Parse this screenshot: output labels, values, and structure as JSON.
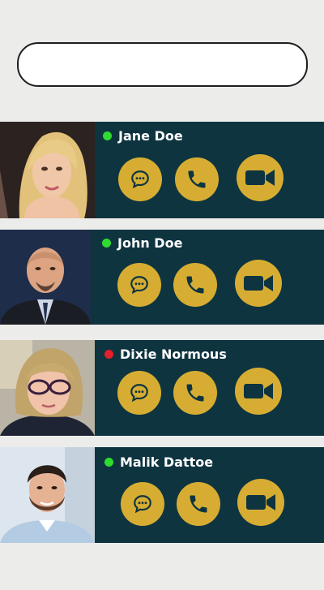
{
  "search": {
    "value": "",
    "placeholder": ""
  },
  "colors": {
    "page_bg": "#ececea",
    "card_bg": "#0e3440",
    "action_gold": "#d6ad32",
    "status_online": "#2fdb2f",
    "status_busy": "#e5202a"
  },
  "contacts": [
    {
      "name": "Jane Doe",
      "status": "online",
      "actions": [
        "chat-icon",
        "phone-icon",
        "video-icon"
      ]
    },
    {
      "name": "John Doe",
      "status": "online",
      "actions": [
        "chat-icon",
        "phone-icon",
        "video-icon"
      ]
    },
    {
      "name": "Dixie Normous",
      "status": "busy",
      "actions": [
        "chat-icon",
        "phone-icon",
        "video-icon"
      ]
    },
    {
      "name": "Malik Dattoe",
      "status": "online",
      "actions": [
        "chat-icon",
        "phone-icon",
        "video-icon"
      ]
    }
  ]
}
